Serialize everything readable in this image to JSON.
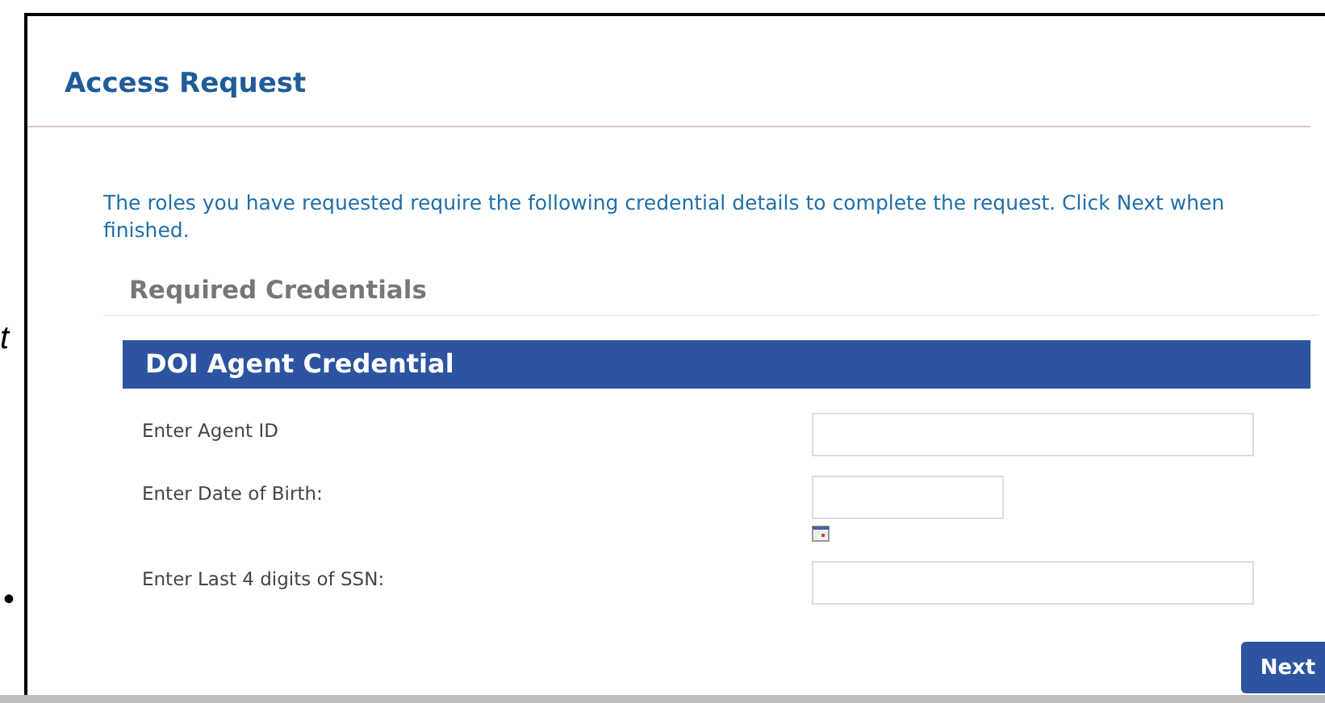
{
  "background_fragments": [
    {
      "text": "t",
      "kind": "italic"
    },
    {
      "text": "•",
      "kind": "bullet"
    }
  ],
  "dialog": {
    "title": "Access Request",
    "intro": "The roles you have requested require the following credential details to complete the request. Click Next when finished.",
    "section_title": "Required Credentials",
    "credential": {
      "title": "DOI Agent Credential",
      "fields": [
        {
          "label": "Enter Agent ID",
          "kind": "text"
        },
        {
          "label": "Enter Date of Birth:",
          "kind": "date"
        },
        {
          "label": "Enter Last 4 digits of SSN:",
          "kind": "text"
        }
      ]
    },
    "buttons": [
      "Next"
    ]
  }
}
